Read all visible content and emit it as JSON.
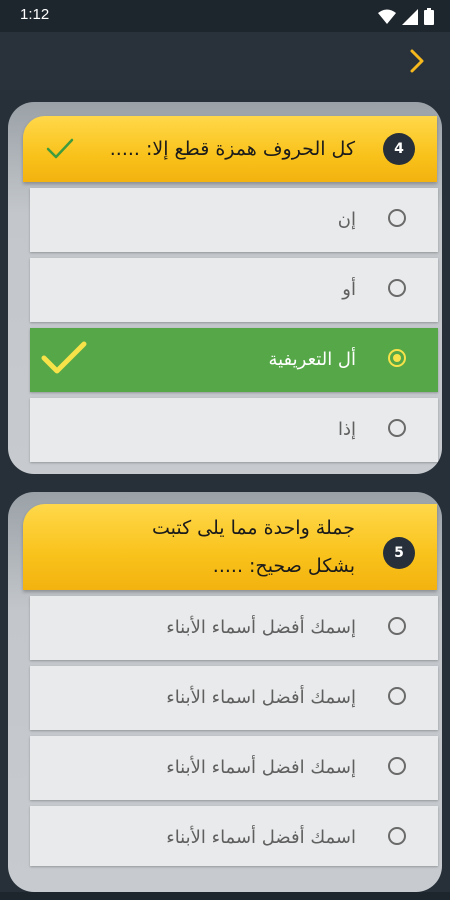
{
  "status_bar": {
    "time": "1:12",
    "icons": [
      "wifi-icon",
      "signal-icon",
      "battery-icon"
    ]
  },
  "app_bar": {
    "nav_icon": "chevron-right-icon",
    "accent_color": "#f9c21b"
  },
  "questions": [
    {
      "number": "4",
      "text": "كل الحروف همزة قطع إلا: .....",
      "answered_correctly": true,
      "options": [
        {
          "label": "إن",
          "selected": false
        },
        {
          "label": "أو",
          "selected": false
        },
        {
          "label": "أل التعريفية",
          "selected": true
        },
        {
          "label": "إذا",
          "selected": false
        }
      ]
    },
    {
      "number": "5",
      "text_line1": "جملة واحدة مما يلى كتبت",
      "text_line2": "بشكل صحيح: .....",
      "options": [
        {
          "label": "إسمك أفضل أسماء الأبناء",
          "selected": false
        },
        {
          "label": "إسمك أفضل اسماء الأبناء",
          "selected": false
        },
        {
          "label": "إسمك افضل أسماء الأبناء",
          "selected": false
        },
        {
          "label": "اسمك أفضل أسماء الأبناء",
          "selected": false
        }
      ]
    }
  ],
  "colors": {
    "correct": "#55a748",
    "header_yellow": "#f9c21b",
    "background": "#273039"
  }
}
